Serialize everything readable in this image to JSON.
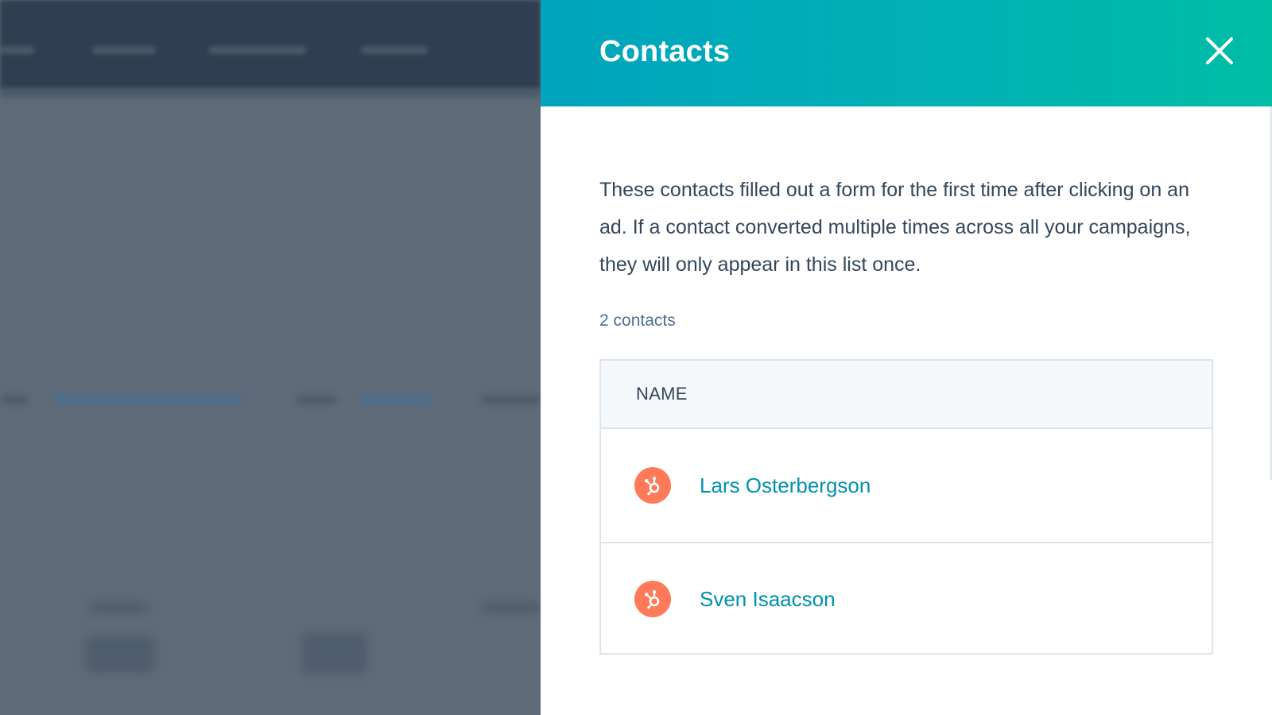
{
  "panel": {
    "title": "Contacts",
    "description": "These contacts filled out a form for the first time after clicking on an ad. If a contact converted multiple times across all your campaigns, they will only appear in this list once.",
    "count_label": "2 contacts",
    "header_gradient": [
      "#00a4bd",
      "#00bda5"
    ]
  },
  "table": {
    "columns": [
      {
        "label": "NAME"
      }
    ],
    "rows": [
      {
        "name": "Lars Osterbergson",
        "avatar_icon": "hubspot-sprocket-icon"
      },
      {
        "name": "Sven Isaacson",
        "avatar_icon": "hubspot-sprocket-icon"
      }
    ]
  },
  "colors": {
    "accent_link": "#0091ae",
    "avatar_orange": "#ff7a59",
    "text": "#33475b"
  }
}
